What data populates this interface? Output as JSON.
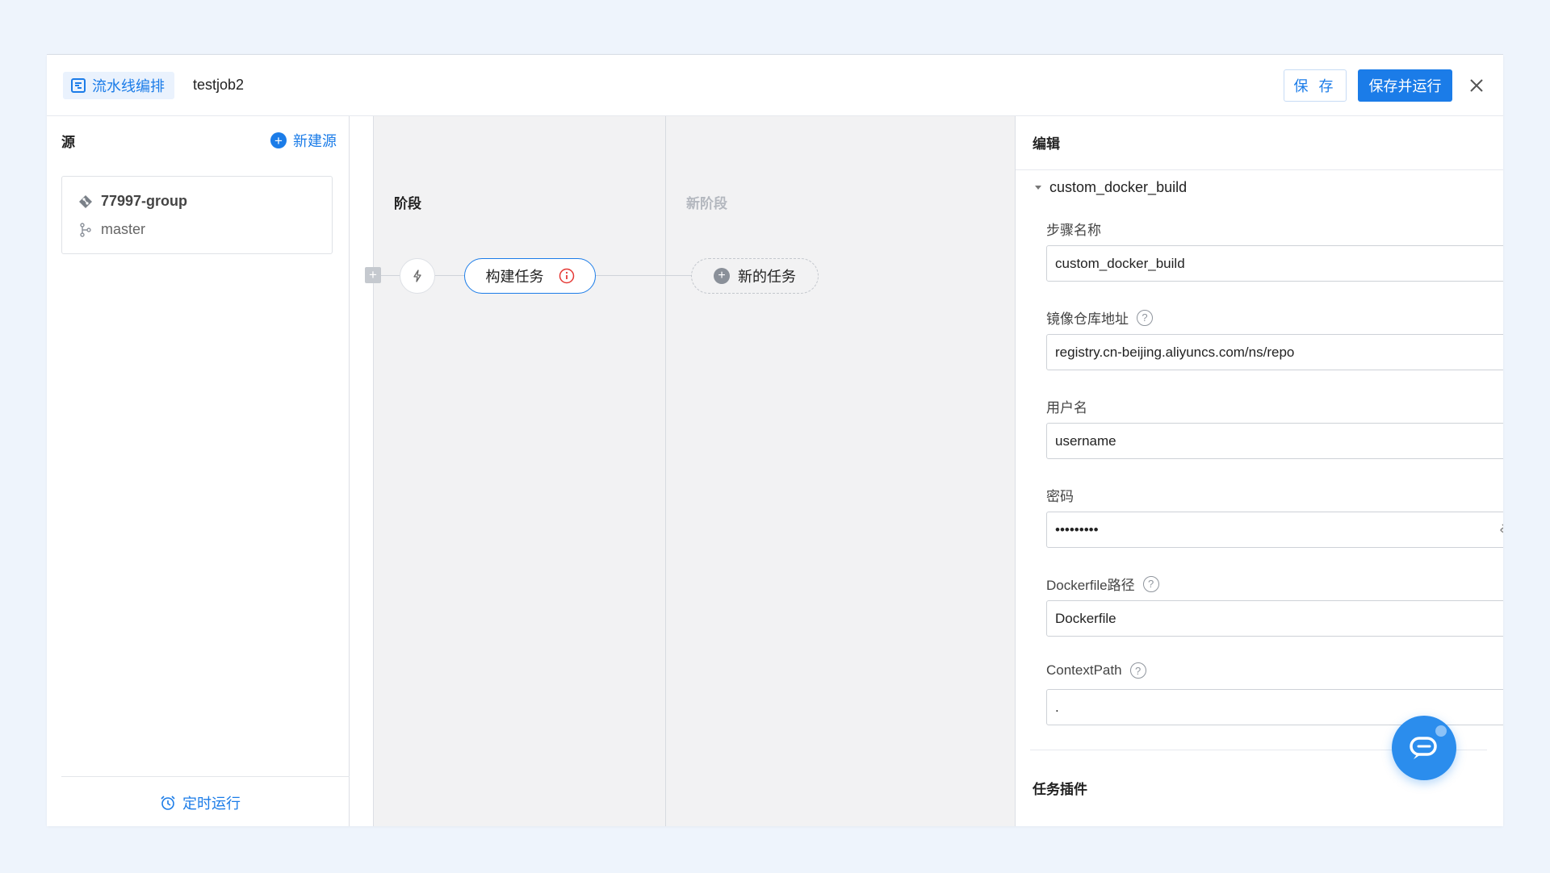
{
  "header": {
    "chip_label": "流水线编排",
    "job_name": "testjob2",
    "save_label": "保 存",
    "save_run_label": "保存并运行"
  },
  "source_panel": {
    "title": "源",
    "new_source_label": "新建源",
    "card": {
      "repo": "77997-group",
      "branch": "master"
    },
    "timer_label": "定时运行"
  },
  "canvas": {
    "stage_title": "阶段",
    "new_stage_title": "新阶段",
    "task_label": "构建任务",
    "new_task_label": "新的任务"
  },
  "edit_panel": {
    "title": "编辑",
    "section_name": "custom_docker_build",
    "fields": {
      "step_name": {
        "label": "步骤名称",
        "value": "custom_docker_build"
      },
      "registry": {
        "label": "镜像仓库地址",
        "value": "registry.cn-beijing.aliyuncs.com/ns/repo"
      },
      "username": {
        "label": "用户名",
        "value": "username"
      },
      "password": {
        "label": "密码",
        "value": "•••••••••"
      },
      "dockerfile": {
        "label": "Dockerfile路径",
        "value": "Dockerfile"
      },
      "context_path": {
        "label": "ContextPath",
        "value": "."
      }
    },
    "plugins_title": "任务插件"
  },
  "colors": {
    "accent": "#1b7ce8",
    "error": "#e53935",
    "page_bg": "#eef4fc",
    "stage_bg": "#f2f2f3"
  },
  "icons": {
    "chip": "pipeline-icon",
    "close": "close-icon",
    "trigger": "lightning-icon",
    "task_warning": "info-circle-icon",
    "repo": "git-icon",
    "branch": "branch-icon",
    "timer": "alarm-clock-icon",
    "password_toggle": "eye-off-icon",
    "chat": "chat-icon"
  }
}
